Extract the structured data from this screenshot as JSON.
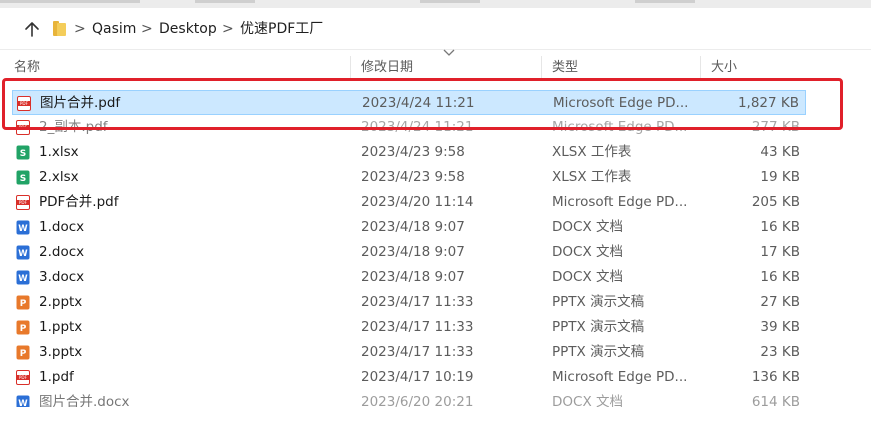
{
  "breadcrumb": {
    "items": [
      "Qasim",
      "Desktop",
      "优速PDF工厂"
    ],
    "separator": ">"
  },
  "columns": {
    "name": "名称",
    "date": "修改日期",
    "type": "类型",
    "size": "大小"
  },
  "files": [
    {
      "name": "图片合并.pdf",
      "date": "2023/4/24 11:21",
      "type": "Microsoft Edge PD...",
      "size": "1,827 KB",
      "icon": "pdf-icon",
      "selected": true
    },
    {
      "name": "2_副本.pdf",
      "date": "2023/4/24 11:21",
      "type": "Microsoft Edge PD...",
      "size": "277 KB",
      "icon": "pdf-icon",
      "selected": false
    },
    {
      "name": "1.xlsx",
      "date": "2023/4/23 9:58",
      "type": "XLSX 工作表",
      "size": "43 KB",
      "icon": "excel-icon",
      "selected": false
    },
    {
      "name": "2.xlsx",
      "date": "2023/4/23 9:58",
      "type": "XLSX 工作表",
      "size": "19 KB",
      "icon": "excel-icon",
      "selected": false
    },
    {
      "name": "PDF合并.pdf",
      "date": "2023/4/20 11:14",
      "type": "Microsoft Edge PD...",
      "size": "205 KB",
      "icon": "pdf-icon",
      "selected": false
    },
    {
      "name": "1.docx",
      "date": "2023/4/18 9:07",
      "type": "DOCX 文档",
      "size": "16 KB",
      "icon": "word-icon",
      "selected": false
    },
    {
      "name": "2.docx",
      "date": "2023/4/18 9:07",
      "type": "DOCX 文档",
      "size": "17 KB",
      "icon": "word-icon",
      "selected": false
    },
    {
      "name": "3.docx",
      "date": "2023/4/18 9:07",
      "type": "DOCX 文档",
      "size": "16 KB",
      "icon": "word-icon",
      "selected": false
    },
    {
      "name": "2.pptx",
      "date": "2023/4/17 11:33",
      "type": "PPTX 演示文稿",
      "size": "27 KB",
      "icon": "ppt-icon",
      "selected": false
    },
    {
      "name": "1.pptx",
      "date": "2023/4/17 11:33",
      "type": "PPTX 演示文稿",
      "size": "39 KB",
      "icon": "ppt-icon",
      "selected": false
    },
    {
      "name": "3.pptx",
      "date": "2023/4/17 11:33",
      "type": "PPTX 演示文稿",
      "size": "23 KB",
      "icon": "ppt-icon",
      "selected": false
    },
    {
      "name": "1.pdf",
      "date": "2023/4/17 10:19",
      "type": "Microsoft Edge PD...",
      "size": "136 KB",
      "icon": "pdf-icon",
      "selected": false
    },
    {
      "name": "图片合并.docx",
      "date": "2023/6/20 20:21",
      "type": "DOCX 文档",
      "size": "614 KB",
      "icon": "word-icon",
      "selected": false
    }
  ],
  "colors": {
    "selection": "#cce8ff",
    "highlight_box": "#e0202a",
    "pdf": "#d9302a",
    "excel": "#21a366",
    "word": "#2b6fd6",
    "ppt": "#e8792b"
  }
}
